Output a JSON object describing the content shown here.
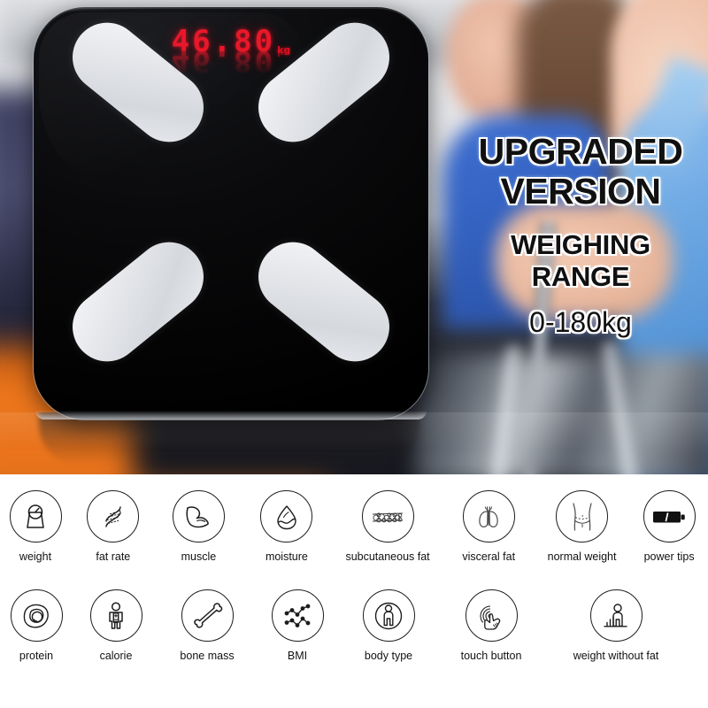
{
  "product": {
    "display_value": "46.80",
    "display_unit": "kg",
    "display_color": "#e8182a",
    "body_color": "#000000",
    "electrode_pads": 4
  },
  "marketing": {
    "line1": "UPGRADED",
    "line2": "VERSION",
    "line3": "WEIGHING",
    "line4": "RANGE",
    "range_value": "0-180kg",
    "text_color": "#101010",
    "outline_color": "#ffffff"
  },
  "features": {
    "row1": [
      {
        "icon": "bathroom-scale-icon",
        "label": "weight"
      },
      {
        "icon": "dna-helix-icon",
        "label": "fat rate"
      },
      {
        "icon": "flexed-arm-icon",
        "label": "muscle"
      },
      {
        "icon": "water-drop-icon",
        "label": "moisture"
      },
      {
        "icon": "fat-cells-icon",
        "label": "subcutaneous fat"
      },
      {
        "icon": "lungs-organ-icon",
        "label": "visceral fat"
      },
      {
        "icon": "waistline-icon",
        "label": "normal weight"
      },
      {
        "icon": "battery-icon",
        "label": "power tips"
      }
    ],
    "row2": [
      {
        "icon": "egg-icon",
        "label": "protein"
      },
      {
        "icon": "person-battery-icon",
        "label": "calorie"
      },
      {
        "icon": "bone-icon",
        "label": "bone mass"
      },
      {
        "icon": "line-chart-icon",
        "label": "BMI"
      },
      {
        "icon": "person-in-circle-icon",
        "label": "body type"
      },
      {
        "icon": "hand-touch-icon",
        "label": "touch button"
      },
      {
        "icon": "person-bars-icon",
        "label": "weight without fat"
      }
    ]
  }
}
